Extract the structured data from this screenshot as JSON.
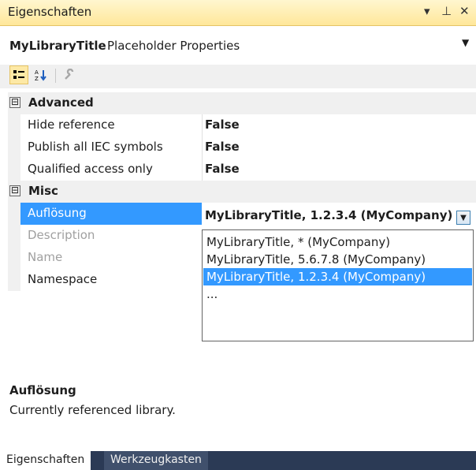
{
  "window": {
    "title": "Eigenschaften",
    "controls": [
      "▾",
      "⊥",
      "✕"
    ]
  },
  "object_selector": {
    "name": "MyLibraryTitle",
    "type": "Placeholder Properties"
  },
  "toolbar": {
    "buttons": [
      "categorized-icon",
      "alphabetical-icon",
      "property-pages-icon"
    ]
  },
  "grid": {
    "categories": [
      {
        "label": "Advanced",
        "toggle": "⊟"
      },
      {
        "label": "Misc",
        "toggle": "⊟"
      }
    ],
    "advanced_rows": [
      {
        "name": "Hide reference",
        "value": "False"
      },
      {
        "name": "Publish all IEC symbols",
        "value": "False"
      },
      {
        "name": "Qualified access only",
        "value": "False"
      }
    ],
    "misc_rows": [
      {
        "name": "Auflösung",
        "value": "MyLibraryTitle, 1.2.3.4 (MyCompany)"
      },
      {
        "name": "Description",
        "value": ""
      },
      {
        "name": "Name",
        "value": ""
      },
      {
        "name": "Namespace",
        "value": ""
      }
    ]
  },
  "dropdown": {
    "selected": "MyLibraryTitle, 1.2.3.4 (MyCompany)",
    "options": [
      "MyLibraryTitle, * (MyCompany)",
      "MyLibraryTitle, 5.6.7.8 (MyCompany)",
      "MyLibraryTitle, 1.2.3.4 (MyCompany)",
      "..."
    ]
  },
  "description": {
    "heading": "Auflösung",
    "text": "Currently referenced library."
  },
  "tabs": [
    {
      "label": "Eigenschaften",
      "active": true
    },
    {
      "label": "Werkzeugkasten",
      "active": false
    }
  ],
  "colors": {
    "selection": "#3399ff",
    "titlebar": "#ffe79a",
    "tabstrip": "#2b3a55"
  }
}
